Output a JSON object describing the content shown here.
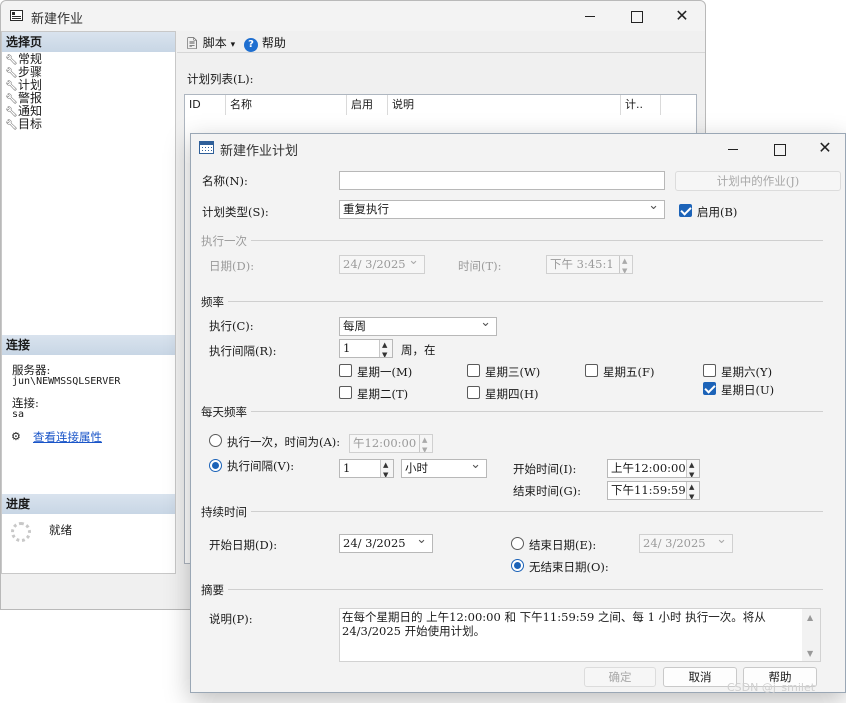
{
  "job_window": {
    "title": "新建作业",
    "toolbar": {
      "script_label": "脚本",
      "help_label": "帮助"
    },
    "select_page": {
      "header": "选择页",
      "items": [
        "常规",
        "步骤",
        "计划",
        "警报",
        "通知",
        "目标"
      ]
    },
    "connection": {
      "header": "连接",
      "server_label": "服务器:",
      "server_value": "jun\\NEWMSSQLSERVER",
      "connection_label": "连接:",
      "connection_value": "sa",
      "view_properties_link": "查看连接属性"
    },
    "progress": {
      "header": "进度",
      "status": "就绪"
    },
    "schedule_list": {
      "label": "计划列表(L):",
      "columns": [
        "ID",
        "名称",
        "启用",
        "说明",
        "计.."
      ]
    }
  },
  "schedule_dialog": {
    "title": "新建作业计划",
    "name_label": "名称(N):",
    "name_value": "",
    "jobs_in_schedule_button": "计划中的作业(J)",
    "schedule_type_label": "计划类型(S):",
    "schedule_type_value": "重复执行",
    "enabled_label": "启用(B)",
    "enabled_checked": true,
    "one_time": {
      "group": "执行一次",
      "date_label": "日期(D):",
      "date_value": "24/ 3/2025",
      "time_label": "时间(T):",
      "time_value": "下午 3:45:1"
    },
    "frequency": {
      "group": "频率",
      "occurs_label": "执行(C):",
      "occurs_value": "每周",
      "recurs_label": "执行间隔(R):",
      "recurs_value": "1",
      "recurs_suffix": "周，在",
      "days": [
        {
          "label": "星期一(M)",
          "checked": false
        },
        {
          "label": "星期三(W)",
          "checked": false
        },
        {
          "label": "星期五(F)",
          "checked": false
        },
        {
          "label": "星期六(Y)",
          "checked": false
        },
        {
          "label": "星期二(T)",
          "checked": false
        },
        {
          "label": "星期四(H)",
          "checked": false
        },
        {
          "label": "星期日(U)",
          "checked": true
        }
      ]
    },
    "daily_frequency": {
      "group": "每天频率",
      "once_label": "执行一次，时间为(A):",
      "once_time": "午12:00:00",
      "every_label": "执行间隔(V):",
      "every_value": "1",
      "every_unit": "小时",
      "start_time_label": "开始时间(I):",
      "start_time_value": "上午12:00:00",
      "end_time_label": "结束时间(G):",
      "end_time_value": "下午11:59:59",
      "selected": "every"
    },
    "duration": {
      "group": "持续时间",
      "start_date_label": "开始日期(D):",
      "start_date_value": "24/ 3/2025",
      "end_date_label": "结束日期(E):",
      "end_date_value": "24/ 3/2025",
      "no_end_date_label": "无结束日期(O):",
      "selected": "no_end_date"
    },
    "summary": {
      "group": "摘要",
      "description_label": "说明(P):",
      "description_line1": "在每个星期日的 上午12:00:00 和 下午11:59:59 之间、每 1 小时 执行一次。将从",
      "description_line2": "24/3/2025 开始使用计划。"
    },
    "buttons": {
      "ok": "确定",
      "cancel": "取消",
      "help": "帮助"
    }
  },
  "watermark": "CSDN @j_smilet"
}
